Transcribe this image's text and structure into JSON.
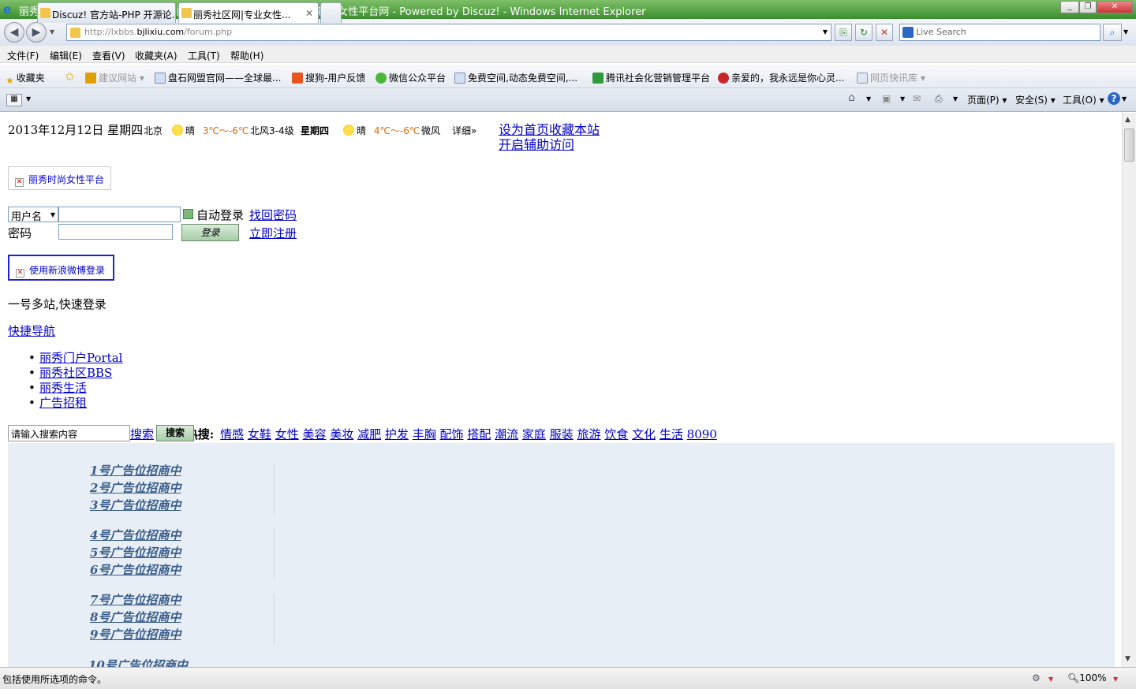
{
  "window": {
    "title": "丽秀社区网|专业女性时尚生活综合门户网站!丽秀女性网站-值得信赖的女性平台网 - Powered by Discuz! - Windows Internet Explorer",
    "url_prefix": "http://lxbbs.",
    "url_domain": "bjlixiu.com",
    "url_path": "/forum.php",
    "search_placeholder": "Live Search"
  },
  "menu": [
    "文件(F)",
    "编辑(E)",
    "查看(V)",
    "收藏夹(A)",
    "工具(T)",
    "帮助(H)"
  ],
  "favorites": {
    "favorites_label": "收藏夹",
    "items": [
      "建议网站 ▾",
      "盘石网盟官网——全球最...",
      "搜狗-用户反馈",
      "微信公众平台",
      "免费空间,动态免费空间,...",
      "腾讯社会化营销管理平台",
      "亲爱的，我永远是你心灵...",
      "网页快讯库 ▾"
    ]
  },
  "tabs": [
    "Discuz! 官方站-PHP 开源论...",
    "丽秀社区网|专业女性..."
  ],
  "commandbar": {
    "page": "页面(P) ▾",
    "safety": "安全(S) ▾",
    "tools": "工具(O) ▾"
  },
  "header": {
    "date": "2013年12月12日 星期四",
    "city": "北京",
    "today": {
      "cond": "晴",
      "temp": "3℃～-6℃",
      "wind": "北风3-4级"
    },
    "tomorrow_label": "星期四",
    "tomorrow": {
      "cond": "晴",
      "temp": "4℃～-6℃",
      "wind": "微风"
    },
    "detail": "详细»",
    "set_home": "设为首页收藏本站",
    "accessibility": "开启辅助访问"
  },
  "logo_alt": "丽秀时尚女性平台",
  "login": {
    "field_select": "用户名",
    "auto_login": "自动登录",
    "find_password": "找回密码",
    "password_label": "密码",
    "login_button": "登录",
    "register": "立即注册",
    "weibo": "使用新浪微博登录",
    "one_account": "一号多站,快速登录"
  },
  "quick_nav": "快捷导航",
  "nav_items": [
    "丽秀门户Portal",
    "丽秀社区BBS",
    "丽秀生活",
    "广告招租"
  ],
  "search": {
    "placeholder": "请输入搜索内容",
    "search_link": "搜索",
    "search_button": "搜索",
    "hot_label": "热搜:",
    "hot_terms": [
      "情感",
      "女鞋",
      "女性",
      "美容",
      "美妆",
      "减肥",
      "护发",
      "丰胸",
      "配饰",
      "搭配",
      "潮流",
      "家庭",
      "服装",
      "旅游",
      "饮食",
      "文化",
      "生活",
      "8090"
    ]
  },
  "ads": [
    "1号广告位招商中",
    "2号广告位招商中",
    "3号广告位招商中",
    "4号广告位招商中",
    "5号广告位招商中",
    "6号广告位招商中",
    "7号广告位招商中",
    "8号广告位招商中",
    "9号广告位招商中",
    "10号广告位招商中"
  ],
  "status": {
    "message": "包括使用所选项的命令。",
    "zoom": "100%"
  }
}
